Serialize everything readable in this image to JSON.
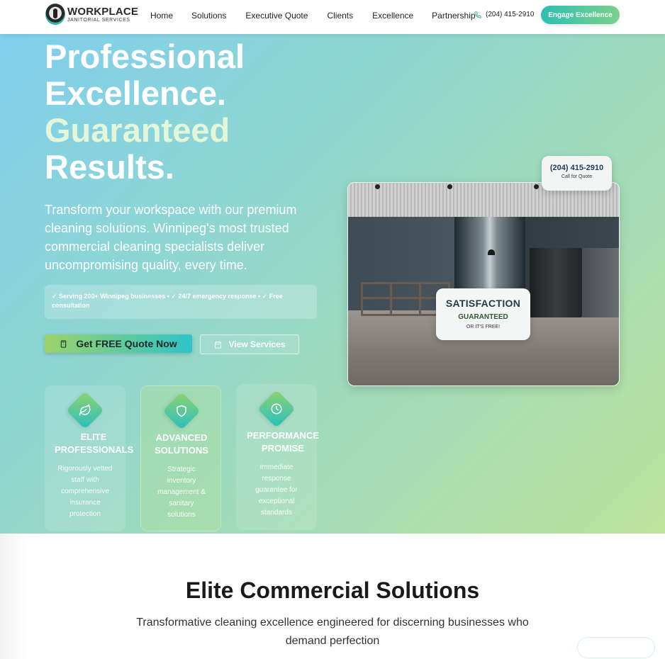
{
  "navbar": {
    "logo_title": "WORKPLACE",
    "logo_subtitle": "JANITORIAL SERVICES",
    "links": [
      "Home",
      "Solutions",
      "Executive Quote",
      "Clients",
      "Excellence",
      "Partnership"
    ],
    "phone": "(204) 415-2910",
    "cta_label": "Engage Excellence",
    "icons": {
      "phone": "phone-icon"
    }
  },
  "hero": {
    "title_line1": "Professional",
    "title_line2": "Excellence.",
    "title_line3": "Guaranteed",
    "title_line4": "Results.",
    "description": "Transform your workspace with our premium cleaning solutions. Winnipeg's most trusted commercial cleaning specialists deliver uncompromising quality, every time.",
    "trust_line": "✓ Serving 200+ Winnipeg businesses • ✓ 24/7 emergency response • ✓ Free consultation",
    "primary_cta": "Get FREE Quote Now",
    "secondary_cta": "View Services",
    "features": [
      {
        "title": "ELITE PROFESSIONALS",
        "description": "Rigorously vetted staff with comprehensive insurance protection",
        "icon": "leaf-icon"
      },
      {
        "title": "ADVANCED SOLUTIONS",
        "description": "Strategic inventory management & sanitary solutions",
        "icon": "shield-icon"
      },
      {
        "title": "PERFORMANCE PROMISE",
        "description": "Immediate response guarantee for exceptional standards",
        "icon": "clock-icon"
      }
    ],
    "phone_badge": {
      "number": "(204) 415-2910",
      "label": "Call for Quote"
    },
    "satisfaction_badge": {
      "title": "SATISFACTION",
      "subtitle": "GUARANTEED",
      "note": "OR IT'S FREE!"
    }
  },
  "solutions": {
    "title": "Elite Commercial Solutions",
    "subtitle": "Transformative cleaning excellence engineered for discerning businesses who demand perfection"
  },
  "colors": {
    "accent_teal": "#2cbfb4",
    "accent_green": "#7dd08a",
    "hero_start": "#7fcfee",
    "hero_end": "#bde39b"
  }
}
